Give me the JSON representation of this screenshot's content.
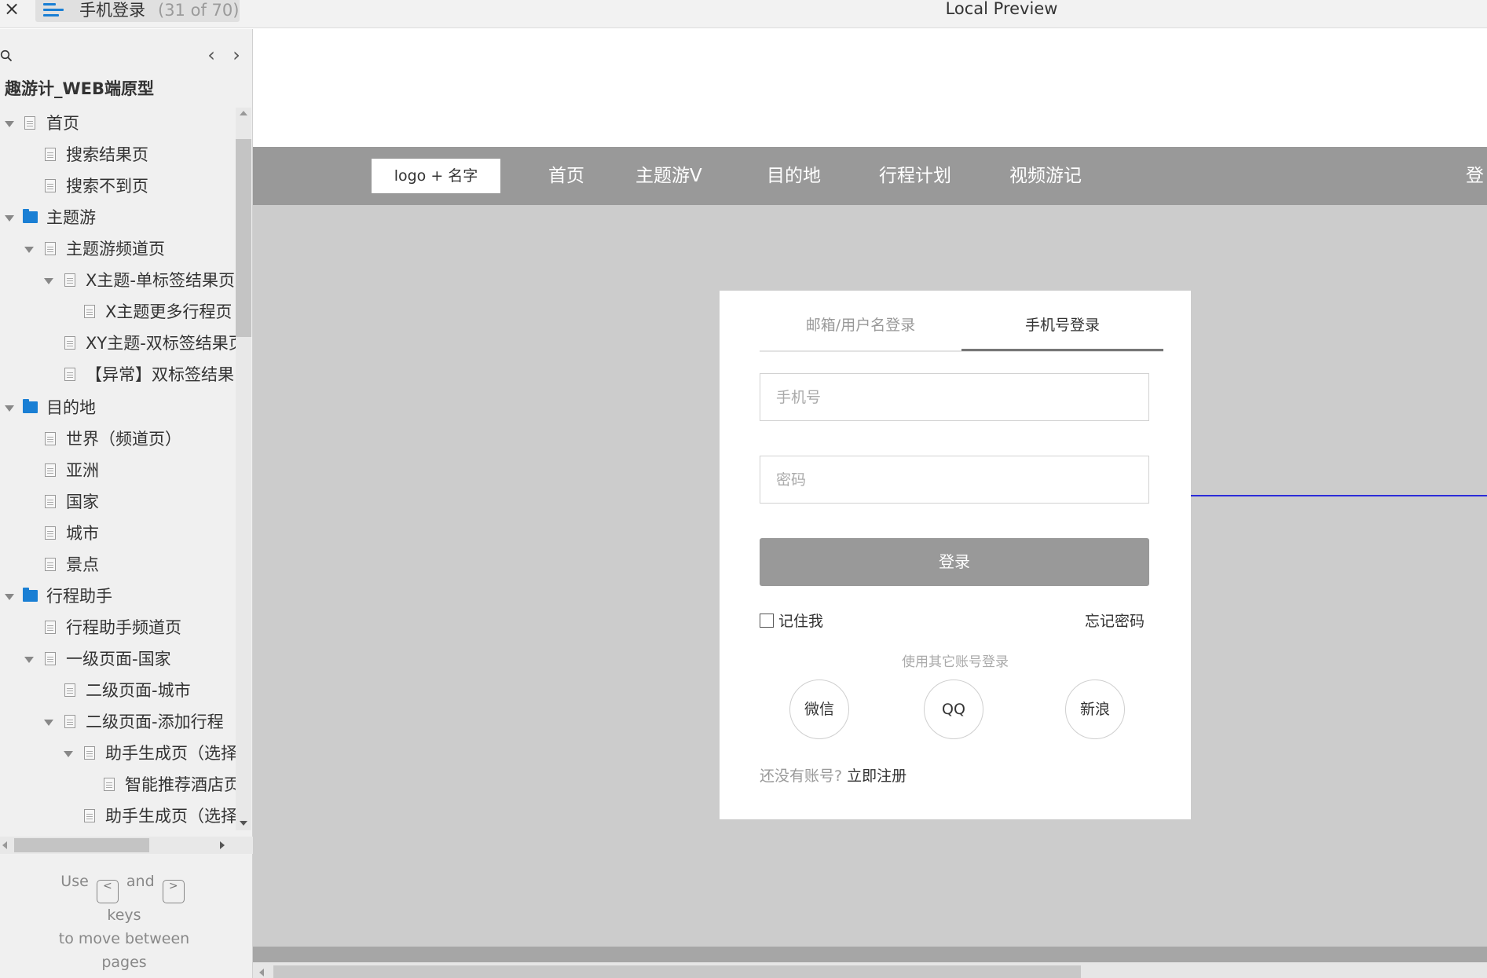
{
  "topbar": {
    "close_glyph": "×",
    "page_title": "手机登录",
    "page_count": "(31 of 70)",
    "preview_title": "Local Preview"
  },
  "sidebar": {
    "project_title": "趣游计_WEB端原型",
    "nav_prev": "‹",
    "nav_next": "›",
    "tree": [
      {
        "label": "首页",
        "type": "page",
        "expanded": true
      },
      {
        "label": "搜索结果页",
        "type": "page"
      },
      {
        "label": "搜索不到页",
        "type": "page"
      },
      {
        "label": "主题游",
        "type": "folder",
        "expanded": true
      },
      {
        "label": "主题游频道页",
        "type": "page",
        "expanded": true
      },
      {
        "label": "X主题-单标签结果页",
        "type": "page",
        "expanded": true
      },
      {
        "label": "X主题更多行程页",
        "type": "page"
      },
      {
        "label": "XY主题-双标签结果页",
        "type": "page"
      },
      {
        "label": "【异常】双标签结果",
        "type": "page"
      },
      {
        "label": "目的地",
        "type": "folder",
        "expanded": true
      },
      {
        "label": "世界（频道页）",
        "type": "page"
      },
      {
        "label": "亚洲",
        "type": "page"
      },
      {
        "label": "国家",
        "type": "page"
      },
      {
        "label": "城市",
        "type": "page"
      },
      {
        "label": "景点",
        "type": "page"
      },
      {
        "label": "行程助手",
        "type": "folder",
        "expanded": true
      },
      {
        "label": "行程助手频道页",
        "type": "page"
      },
      {
        "label": "一级页面-国家",
        "type": "page",
        "expanded": true
      },
      {
        "label": "二级页面-城市",
        "type": "page"
      },
      {
        "label": "二级页面-添加行程",
        "type": "page",
        "expanded": true
      },
      {
        "label": "助手生成页（选择",
        "type": "page",
        "expanded": true
      },
      {
        "label": "智能推荐酒店页",
        "type": "page"
      },
      {
        "label": "助手生成页（选择",
        "type": "page"
      }
    ],
    "help": {
      "use": "Use",
      "key_prev": "<",
      "and": "and",
      "key_next": ">",
      "keys": "keys",
      "line3": "to move between",
      "line4": "pages"
    }
  },
  "site": {
    "logo": "logo + 名字",
    "nav": [
      "首页",
      "主题游V",
      "目的地",
      "行程计划",
      "视频游记",
      "登"
    ]
  },
  "login": {
    "tabs": [
      "邮箱/用户名登录",
      "手机号登录"
    ],
    "active_tab": 1,
    "phone_placeholder": "手机号",
    "password_placeholder": "密码",
    "login_button": "登录",
    "remember_me": "记住我",
    "remember_checked": false,
    "forgot_password": "忘记密码",
    "other_login": "使用其它账号登录",
    "social": [
      "微信",
      "QQ",
      "新浪"
    ],
    "no_account": "还没有账号?",
    "register_link": "立即注册"
  },
  "colors": {
    "accent_blue": "#1a7fd4",
    "nav_bg": "#999999",
    "canvas_bg": "#cccccc",
    "connector_line": "#2b2bd9"
  }
}
